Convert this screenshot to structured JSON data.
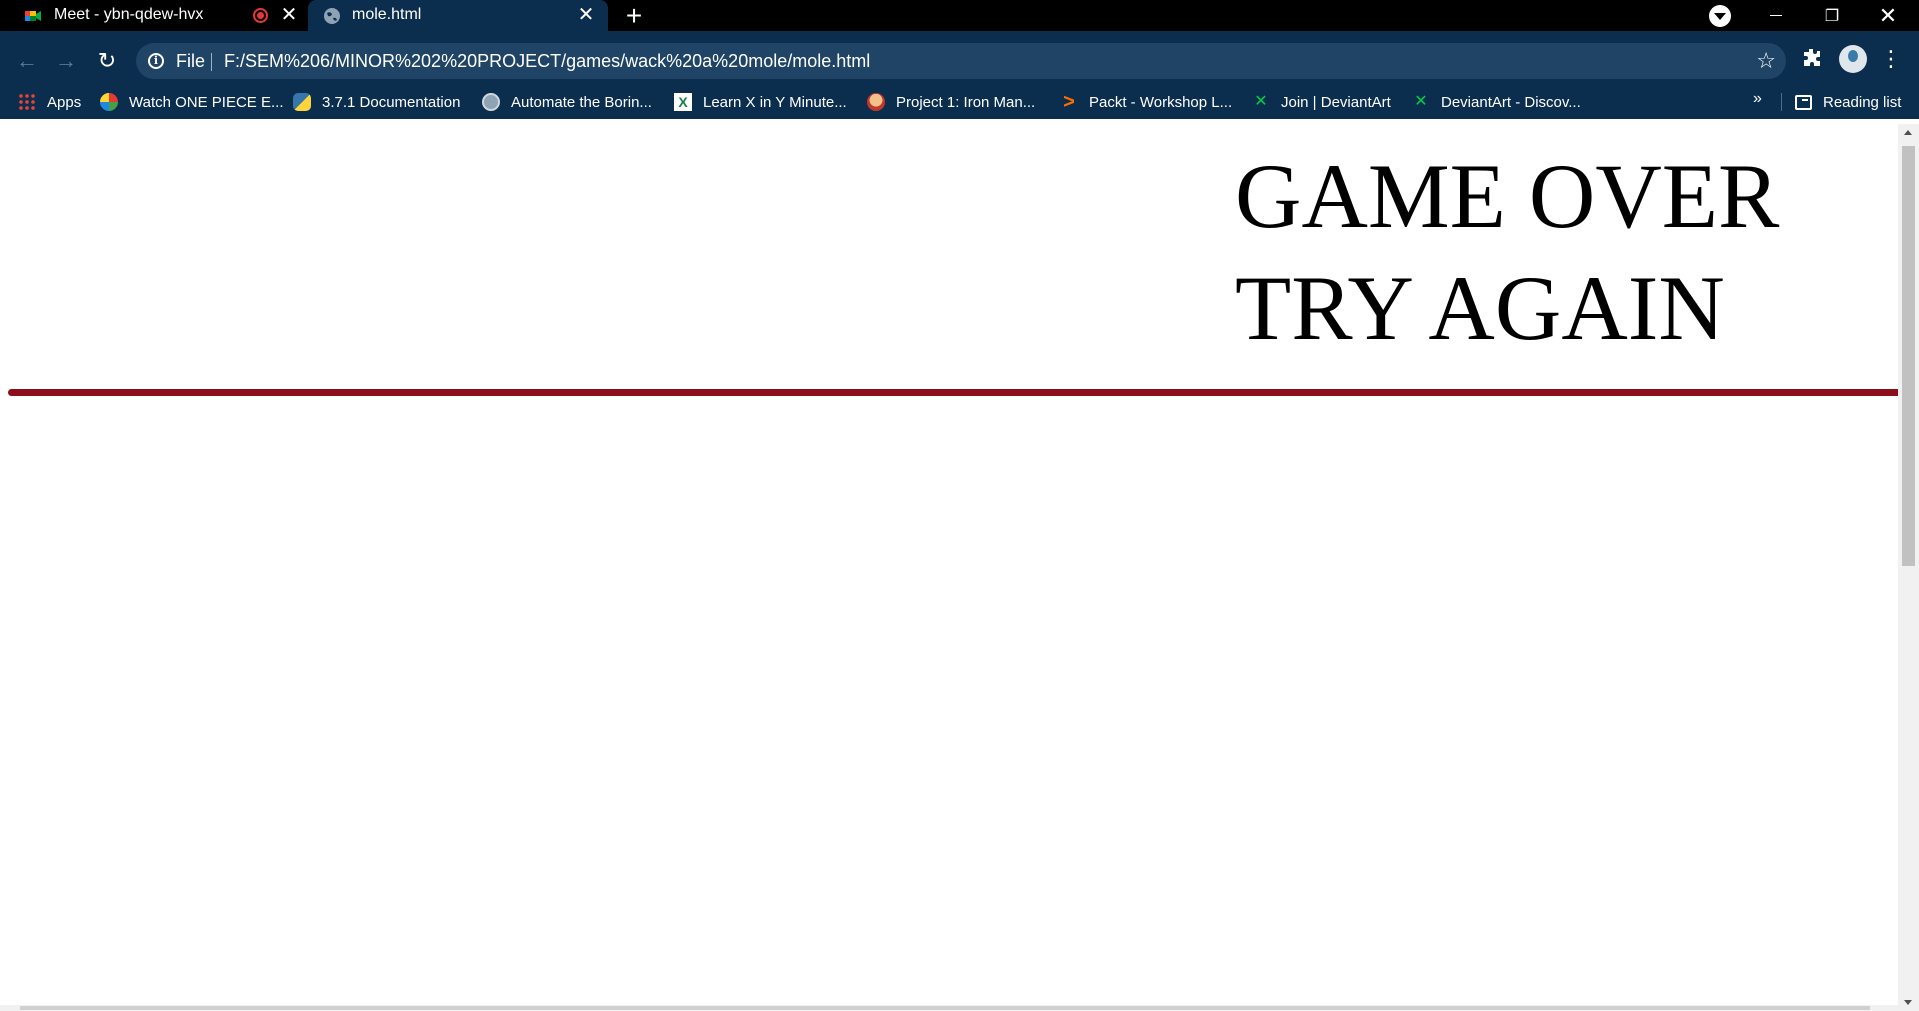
{
  "browser": {
    "tabs": [
      {
        "title": "Meet - ybn-qdew-hvx",
        "favicon": "google-meet-icon",
        "recording": true
      },
      {
        "title": "mole.html",
        "favicon": "globe-icon",
        "active": true
      }
    ],
    "new_tab_label": "+",
    "close_glyph": "✕",
    "window_controls": {
      "minimize": "",
      "maximize": "❐",
      "close": "✕"
    }
  },
  "toolbar": {
    "back_glyph": "←",
    "forward_glyph": "→",
    "reload_glyph": "↻",
    "scheme_label": "File",
    "url": "F:/SEM%206/MINOR%202%20PROJECT/games/wack%20a%20mole/mole.html",
    "info_glyph": "i",
    "star_glyph": "☆",
    "extensions_glyph": "✱",
    "menu_glyph": "⋮"
  },
  "bookmarks": {
    "items": [
      {
        "label": "Apps",
        "icon": "apps-grid-icon"
      },
      {
        "label": "Watch ONE PIECE E...",
        "icon": "onepiece-icon"
      },
      {
        "label": "3.7.1 Documentation",
        "icon": "python-icon"
      },
      {
        "label": "Automate the Borin...",
        "icon": "globe-icon"
      },
      {
        "label": "Learn X in Y Minute...",
        "icon": "learnx-icon",
        "glyph": "X"
      },
      {
        "label": "Project 1: Iron Man...",
        "icon": "ironman-icon"
      },
      {
        "label": "Packt - Workshop L...",
        "icon": "packt-icon",
        "glyph": ">"
      },
      {
        "label": "Join | DeviantArt",
        "icon": "deviantart-icon",
        "glyph": "✕"
      },
      {
        "label": "DeviantArt - Discov...",
        "icon": "deviantart-icon",
        "glyph": "✕"
      }
    ],
    "more_glyph": "»",
    "reading_list_label": "Reading list"
  },
  "page": {
    "heading_line1": "GAME OVER",
    "heading_line2": "TRY AGAIN",
    "divider_color": "#8b0e1a"
  },
  "colors": {
    "tabstrip_bg": "#000000",
    "toolbar_bg": "#0c2e4e",
    "omnibox_bg": "#1f4466",
    "recording_red": "#e53935"
  }
}
